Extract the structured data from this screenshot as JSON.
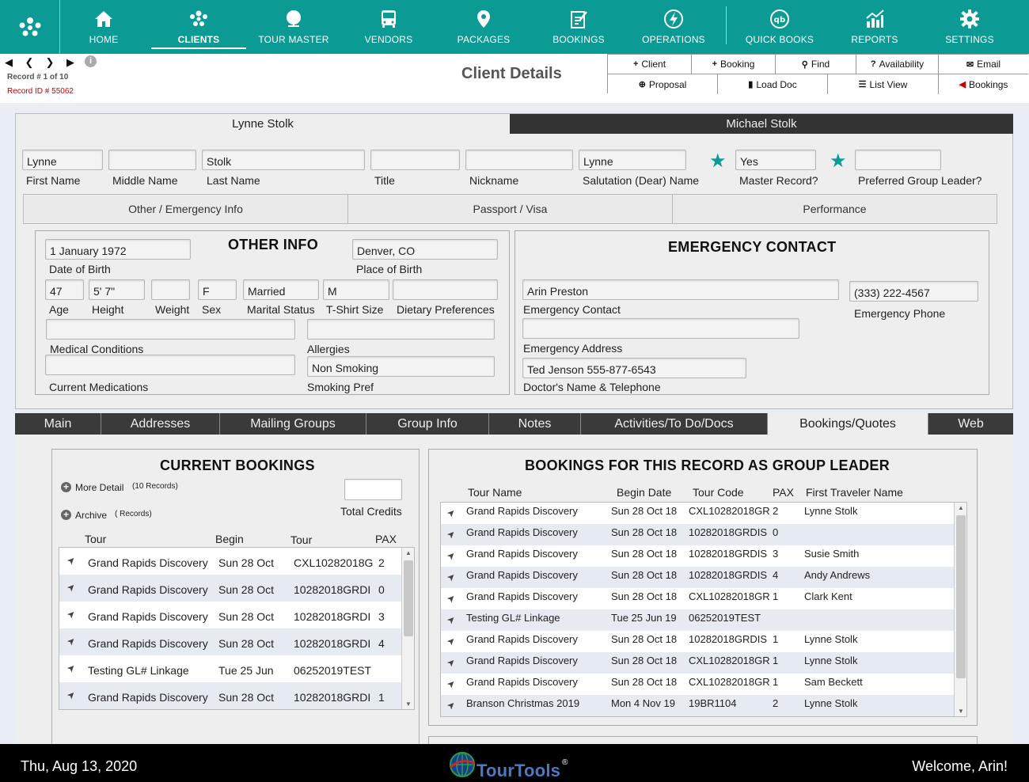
{
  "nav": {
    "items": [
      {
        "label": "HOME",
        "icon": "home-icon"
      },
      {
        "label": "CLIENTS",
        "icon": "clients-icon"
      },
      {
        "label": "TOUR MASTER",
        "icon": "globe-icon"
      },
      {
        "label": "VENDORS",
        "icon": "bus-icon"
      },
      {
        "label": "PACKAGES",
        "icon": "map-pin-icon"
      },
      {
        "label": "BOOKINGS",
        "icon": "clipboard-icon"
      },
      {
        "label": "OPERATIONS",
        "icon": "bolt-icon"
      },
      {
        "label": "QUICK BOOKS",
        "icon": "quickbooks-icon"
      },
      {
        "label": "REPORTS",
        "icon": "chart-icon"
      },
      {
        "label": "SETTINGS",
        "icon": "gear-icon"
      }
    ],
    "active": "CLIENTS"
  },
  "record": {
    "number_label": "Record # 1 of 10",
    "id_label": "Record ID # 55062"
  },
  "page_title": "Client Details",
  "actions": {
    "row1": [
      "Client",
      "Booking",
      "Find",
      "Availability",
      "Email"
    ],
    "row2": [
      "Proposal",
      "Load Doc",
      "List View",
      "Bookings"
    ]
  },
  "person_tabs": [
    "Lynne Stolk",
    "Michael Stolk"
  ],
  "name_fields": {
    "first_name": {
      "label": "First Name",
      "value": "Lynne"
    },
    "middle_name": {
      "label": "Middle Name",
      "value": ""
    },
    "last_name": {
      "label": "Last Name",
      "value": "Stolk"
    },
    "title": {
      "label": "Title",
      "value": ""
    },
    "nickname": {
      "label": "Nickname",
      "value": ""
    },
    "salutation": {
      "label": "Salutation (Dear) Name",
      "value": "Lynne"
    },
    "master_record": {
      "label": "Master Record?",
      "value": "Yes"
    },
    "group_leader": {
      "label": "Preferred Group Leader?",
      "value": ""
    }
  },
  "sub_tabs": [
    "Other / Emergency Info",
    "Passport / Visa",
    "Performance"
  ],
  "other_info": {
    "title": "OTHER INFO",
    "dob": {
      "label": "Date of Birth",
      "value": "1 January 1972"
    },
    "pob": {
      "label": "Place of Birth",
      "value": "Denver, CO"
    },
    "age": {
      "label": "Age",
      "value": "47"
    },
    "height": {
      "label": "Height",
      "value": "5' 7\""
    },
    "weight": {
      "label": "Weight",
      "value": ""
    },
    "sex": {
      "label": "Sex",
      "value": "F"
    },
    "marital": {
      "label": "Marital Status",
      "value": "Married"
    },
    "tshirt": {
      "label": "T-Shirt Size",
      "value": "M"
    },
    "dietary": {
      "label": "Dietary Preferences",
      "value": ""
    },
    "medical": {
      "label": "Medical Conditions",
      "value": ""
    },
    "allergies": {
      "label": "Allergies",
      "value": ""
    },
    "medications": {
      "label": "Current Medications",
      "value": ""
    },
    "smoking": {
      "label": "Smoking Pref",
      "value": "Non Smoking"
    }
  },
  "emergency": {
    "title": "EMERGENCY CONTACT",
    "contact": {
      "label": "Emergency Contact",
      "value": "Arin Preston"
    },
    "phone": {
      "label": "Emergency Phone",
      "value": "(333) 222-4567"
    },
    "address": {
      "label": "Emergency Address",
      "value": ""
    },
    "doctor": {
      "label": "Doctor's Name & Telephone",
      "value": "Ted Jenson 555-877-6543"
    }
  },
  "bottom_tabs": [
    "Main",
    "Addresses",
    "Mailing Groups",
    "Group Info",
    "Notes",
    "Activities/To Do/Docs",
    "Bookings/Quotes",
    "Web"
  ],
  "bottom_active": "Bookings/Quotes",
  "current_bookings": {
    "title": "CURRENT BOOKINGS",
    "more_detail": "More Detail",
    "more_count": "(10 Records)",
    "archive": "Archive",
    "archive_count": "( Records)",
    "total_credits_label": "Total Credits",
    "total_credits_value": "",
    "headers": [
      "Tour",
      "Begin",
      "Tour",
      "PAX"
    ],
    "rows": [
      {
        "tour": "Grand Rapids Discovery",
        "begin": "Sun 28 Oct",
        "code": "CXL10282018G",
        "pax": "2"
      },
      {
        "tour": "Grand Rapids Discovery",
        "begin": "Sun 28 Oct",
        "code": "10282018GRDI",
        "pax": "0"
      },
      {
        "tour": "Grand Rapids Discovery",
        "begin": "Sun 28 Oct",
        "code": "10282018GRDI",
        "pax": "3"
      },
      {
        "tour": "Grand Rapids Discovery",
        "begin": "Sun 28 Oct",
        "code": "10282018GRDI",
        "pax": "4"
      },
      {
        "tour": "Testing GL# Linkage",
        "begin": "Tue 25 Jun",
        "code": "06252019TEST",
        "pax": ""
      },
      {
        "tour": "Grand Rapids Discovery",
        "begin": "Sun 28 Oct",
        "code": "10282018GRDI",
        "pax": "1"
      }
    ]
  },
  "group_leader_bookings": {
    "title": "BOOKINGS FOR THIS RECORD AS GROUP LEADER",
    "headers": [
      "Tour Name",
      "Begin Date",
      "Tour Code",
      "PAX",
      "First Traveler Name"
    ],
    "rows": [
      {
        "tour": "Grand Rapids Discovery",
        "begin": "Sun 28 Oct 18",
        "code": "CXL10282018GR",
        "pax": "2",
        "traveler": "Lynne Stolk"
      },
      {
        "tour": "Grand Rapids Discovery",
        "begin": "Sun 28 Oct 18",
        "code": "10282018GRDIS",
        "pax": "0",
        "traveler": ""
      },
      {
        "tour": "Grand Rapids Discovery",
        "begin": "Sun 28 Oct 18",
        "code": "10282018GRDIS",
        "pax": "3",
        "traveler": "Susie Smith"
      },
      {
        "tour": "Grand Rapids Discovery",
        "begin": "Sun 28 Oct 18",
        "code": "10282018GRDIS",
        "pax": "4",
        "traveler": "Andy Andrews"
      },
      {
        "tour": "Grand Rapids Discovery",
        "begin": "Sun 28 Oct 18",
        "code": "CXL10282018GR",
        "pax": "1",
        "traveler": "Clark Kent"
      },
      {
        "tour": "Testing GL# Linkage",
        "begin": "Tue 25 Jun 19",
        "code": "06252019TEST",
        "pax": "",
        "traveler": ""
      },
      {
        "tour": "Grand Rapids Discovery",
        "begin": "Sun 28 Oct 18",
        "code": "10282018GRDIS",
        "pax": "1",
        "traveler": "Lynne Stolk"
      },
      {
        "tour": "Grand Rapids Discovery",
        "begin": "Sun 28 Oct 18",
        "code": "CXL10282018GR",
        "pax": "1",
        "traveler": "Lynne Stolk"
      },
      {
        "tour": "Grand Rapids Discovery",
        "begin": "Sun 28 Oct 18",
        "code": "CXL10282018GR",
        "pax": "1",
        "traveler": "Sam Beckett"
      },
      {
        "tour": "Branson Christmas 2019",
        "begin": "Mon 4 Nov 19",
        "code": "19BR1104",
        "pax": "2",
        "traveler": "Lynne Stolk"
      }
    ]
  },
  "footer": {
    "date": "Thu, Aug 13, 2020",
    "welcome": "Welcome, Arin!",
    "logo_text": "TourTools",
    "logo_reg": "®"
  },
  "colors": {
    "accent": "#0b9b94",
    "dark_tab": "#333333",
    "record_id": "#cc0000"
  }
}
